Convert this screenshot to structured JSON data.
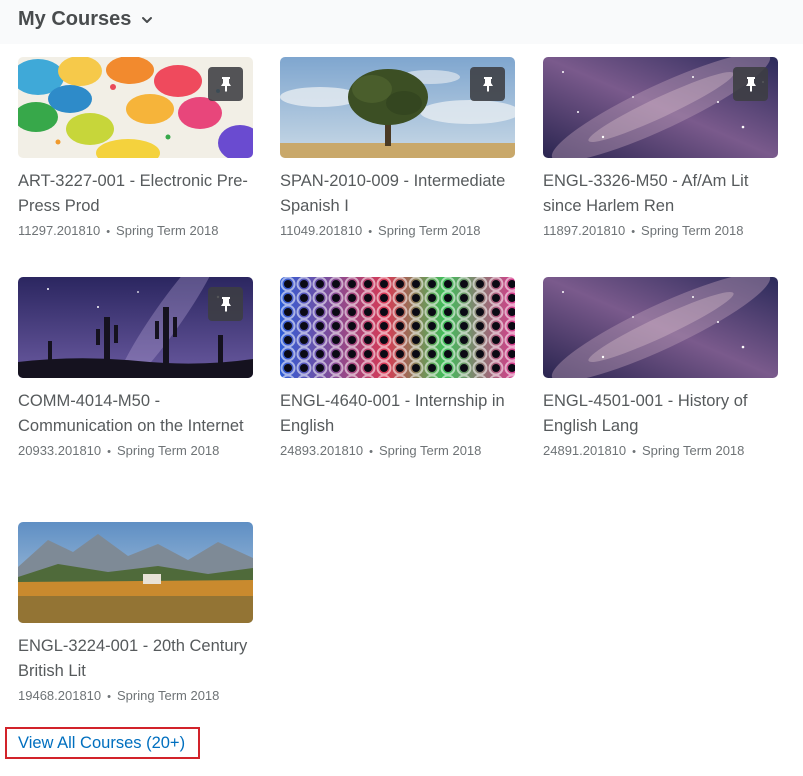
{
  "header": {
    "title": "My Courses",
    "dropdown_icon": "chevron-down-icon"
  },
  "courses": [
    {
      "title": "ART-3227-001 - Electronic Pre-Press Prod",
      "code": "11297.201810",
      "term": "Spring Term 2018",
      "image": "paint-palette",
      "pinned": true
    },
    {
      "title": "SPAN-2010-009 - Intermediate Spanish I",
      "code": "11049.201810",
      "term": "Spring Term 2018",
      "image": "lone-tree",
      "pinned": true
    },
    {
      "title": "ENGL-3326-M50 - Af/Am Lit since Harlem Ren",
      "code": "11897.201810",
      "term": "Spring Term 2018",
      "image": "galaxy",
      "pinned": true
    },
    {
      "title": "COMM-4014-M50 - Communication on the Internet",
      "code": "20933.201810",
      "term": "Spring Term 2018",
      "image": "desert-night-sky",
      "pinned": true
    },
    {
      "title": "ENGL-4640-001 - Internship in English",
      "code": "24893.201810",
      "term": "Spring Term 2018",
      "image": "colored-straws",
      "pinned": false
    },
    {
      "title": "ENGL-4501-001 - History of English Lang",
      "code": "24891.201810",
      "term": "Spring Term 2018",
      "image": "galaxy",
      "pinned": false
    },
    {
      "title": "ENGL-3224-001 - 20th Century British Lit",
      "code": "19468.201810",
      "term": "Spring Term 2018",
      "image": "mountain-lake",
      "pinned": false
    }
  ],
  "meta_separator": "•",
  "footer": {
    "view_all_label": "View All Courses (20+)"
  },
  "colors": {
    "link": "#006fbf",
    "highlight_border": "#d2232a",
    "text": "#494c4e"
  }
}
